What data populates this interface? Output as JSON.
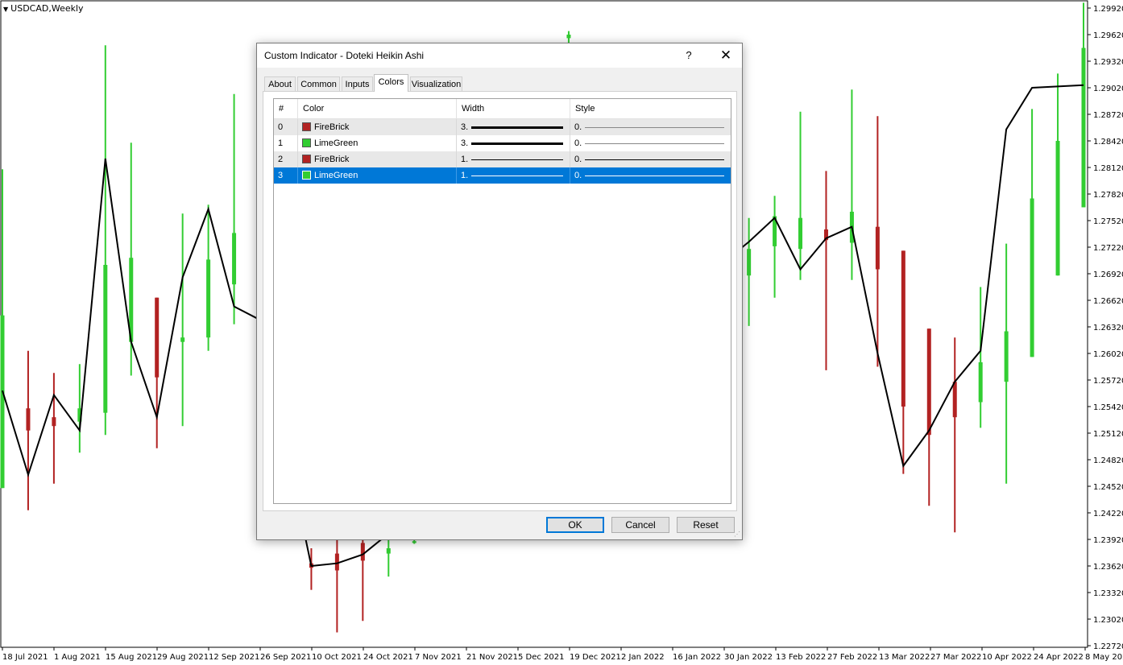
{
  "chart": {
    "symbol": "USDCAD,Weekly",
    "price_labels": [
      "1.29920",
      "1.29620",
      "1.29320",
      "1.29020",
      "1.28720",
      "1.28420",
      "1.28120",
      "1.27820",
      "1.27520",
      "1.27220",
      "1.26920",
      "1.26620",
      "1.26320",
      "1.26020",
      "1.25720",
      "1.25420",
      "1.25120",
      "1.24820",
      "1.24520",
      "1.24220",
      "1.23920",
      "1.23620",
      "1.23320",
      "1.23020",
      "1.22720"
    ],
    "date_labels": [
      "18 Jul 2021",
      "1 Aug 2021",
      "15 Aug 2021",
      "29 Aug 2021",
      "12 Sep 2021",
      "26 Sep 2021",
      "10 Oct 2021",
      "24 Oct 2021",
      "7 Nov 2021",
      "21 Nov 2021",
      "5 Dec 2021",
      "19 Dec 2021",
      "2 Jan 2022",
      "16 Jan 2022",
      "30 Jan 2022",
      "13 Feb 2022",
      "27 Feb 2022",
      "13 Mar 2022",
      "27 Mar 2022",
      "10 Apr 2022",
      "24 Apr 2022",
      "8 May 2022"
    ],
    "colors": {
      "bull": "#32cd32",
      "bear": "#b22222",
      "line": "#000000"
    },
    "candles": [
      {
        "d": "bull",
        "o": 1.245,
        "c": 1.2645,
        "h": 1.281,
        "l": 1.245
      },
      {
        "d": "bear",
        "o": 1.254,
        "c": 1.2515,
        "h": 1.2605,
        "l": 1.2425
      },
      {
        "d": "bear",
        "o": 1.253,
        "c": 1.252,
        "h": 1.258,
        "l": 1.2455
      },
      {
        "d": "bull",
        "o": 1.2525,
        "c": 1.254,
        "h": 1.259,
        "l": 1.249
      },
      {
        "d": "bull",
        "o": 1.2535,
        "c": 1.2702,
        "h": 1.295,
        "l": 1.251
      },
      {
        "d": "bull",
        "o": 1.2615,
        "c": 1.271,
        "h": 1.284,
        "l": 1.2577
      },
      {
        "d": "bear",
        "o": 1.2665,
        "c": 1.2575,
        "h": 1.2665,
        "l": 1.2495
      },
      {
        "d": "bull",
        "o": 1.2615,
        "c": 1.262,
        "h": 1.276,
        "l": 1.252
      },
      {
        "d": "bull",
        "o": 1.262,
        "c": 1.2708,
        "h": 1.277,
        "l": 1.2605
      },
      {
        "d": "bull",
        "o": 1.268,
        "c": 1.2738,
        "h": 1.2895,
        "l": 1.2635
      },
      {
        "d": "bear",
        "o": 1.2365,
        "c": 1.236,
        "h": 1.2382,
        "l": 1.2335
      },
      {
        "d": "bear",
        "o": 1.2376,
        "c": 1.2357,
        "h": 1.2392,
        "l": 1.2287
      },
      {
        "d": "bear",
        "o": 1.2388,
        "c": 1.2368,
        "h": 1.2392,
        "l": 1.23
      },
      {
        "d": "bull",
        "o": 1.2376,
        "c": 1.2382,
        "h": 1.2392,
        "l": 1.235
      },
      {
        "d": "bull",
        "o": 1.2388,
        "c": 1.239,
        "h": 1.2392,
        "l": 1.2387
      },
      {
        "d": "bull",
        "o": 1.2958,
        "c": 1.2962,
        "h": 1.2966,
        "l": 1.295
      },
      {
        "d": "bull",
        "o": 1.269,
        "c": 1.272,
        "h": 1.2755,
        "l": 1.2633
      },
      {
        "d": "bull",
        "o": 1.2723,
        "c": 1.2757,
        "h": 1.278,
        "l": 1.2665
      },
      {
        "d": "bull",
        "o": 1.272,
        "c": 1.2755,
        "h": 1.2875,
        "l": 1.2685
      },
      {
        "d": "bear",
        "o": 1.273,
        "c": 1.2742,
        "h": 1.2808,
        "l": 1.2583
      },
      {
        "d": "bull",
        "o": 1.2727,
        "c": 1.2762,
        "h": 1.29,
        "l": 1.2685
      },
      {
        "d": "bear",
        "o": 1.2745,
        "c": 1.2697,
        "h": 1.287,
        "l": 1.2587
      },
      {
        "d": "bear",
        "o": 1.2718,
        "c": 1.2542,
        "h": 1.2718,
        "l": 1.2466
      },
      {
        "d": "bear",
        "o": 1.263,
        "c": 1.251,
        "h": 1.263,
        "l": 1.243
      },
      {
        "d": "bear",
        "o": 1.257,
        "c": 1.253,
        "h": 1.262,
        "l": 1.24
      },
      {
        "d": "bull",
        "o": 1.2547,
        "c": 1.2592,
        "h": 1.2677,
        "l": 1.2518
      },
      {
        "d": "bull",
        "o": 1.257,
        "c": 1.2627,
        "h": 1.2726,
        "l": 1.2455
      },
      {
        "d": "bull",
        "o": 1.2598,
        "c": 1.2777,
        "h": 1.2878,
        "l": 1.2598
      },
      {
        "d": "bull",
        "o": 1.269,
        "c": 1.2842,
        "h": 1.2918,
        "l": 1.269
      },
      {
        "d": "bull",
        "o": 1.2767,
        "c": 1.2947,
        "h": 1.2998,
        "l": 1.2767
      }
    ],
    "line_points": [
      1.256,
      1.2465,
      1.2555,
      1.2515,
      1.2822,
      1.2615,
      1.253,
      1.2688,
      1.2765,
      1.2655,
      1.264,
      1.2362,
      1.2365,
      1.2375,
      1.2728,
      1.2755,
      1.2697,
      1.2732,
      1.2745,
      1.2602,
      1.2475,
      1.2515,
      1.257,
      1.2605,
      1.2855,
      1.2902,
      1.2905
    ]
  },
  "dialog": {
    "title": "Custom Indicator - Doteki Heikin Ashi",
    "help": "?",
    "close": "✕",
    "tabs": [
      "About",
      "Common",
      "Inputs",
      "Colors",
      "Visualization"
    ],
    "active_tab": "Colors",
    "columns": [
      "#",
      "Color",
      "Width",
      "Style"
    ],
    "rows": [
      {
        "index": "0",
        "color_name": "FireBrick",
        "color": "#b22222",
        "width": "3.",
        "style": "0."
      },
      {
        "index": "1",
        "color_name": "LimeGreen",
        "color": "#32cd32",
        "width": "3.",
        "style": "0."
      },
      {
        "index": "2",
        "color_name": "FireBrick",
        "color": "#b22222",
        "width": "1.",
        "style": "0."
      },
      {
        "index": "3",
        "color_name": "LimeGreen",
        "color": "#32cd32",
        "width": "1.",
        "style": "0."
      }
    ],
    "selected_row": "3",
    "buttons": {
      "ok": "OK",
      "cancel": "Cancel",
      "reset": "Reset"
    }
  }
}
